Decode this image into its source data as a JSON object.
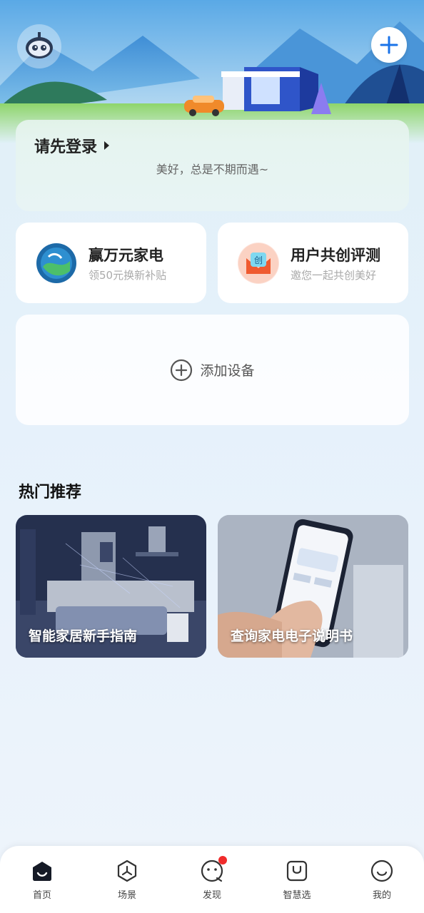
{
  "header": {
    "avatar_icon": "robot-avatar-icon",
    "add_icon": "plus-icon"
  },
  "login": {
    "title": "请先登录",
    "subtitle": "美好，总是不期而遇~"
  },
  "promos": [
    {
      "title": "赢万元家电",
      "subtitle": "领50元换新补贴",
      "icon": "globe-icon"
    },
    {
      "title": "用户共创评测",
      "subtitle": "邀您一起共创美好",
      "icon": "create-badge-icon",
      "badge": "创"
    }
  ],
  "devices": {
    "add_label": "添加设备"
  },
  "recommend": {
    "title": "热门推荐",
    "items": [
      {
        "label": "智能家居新手指南"
      },
      {
        "label": "查询家电电子说明书"
      }
    ]
  },
  "tabbar": {
    "items": [
      {
        "label": "首页",
        "icon": "home-icon"
      },
      {
        "label": "场景",
        "icon": "scene-icon"
      },
      {
        "label": "发现",
        "icon": "discover-icon"
      },
      {
        "label": "智慧选",
        "icon": "shop-icon"
      },
      {
        "label": "我的",
        "icon": "profile-icon"
      }
    ]
  },
  "colors": {
    "accent": "#1a73e8",
    "notify_dot": "#f02b2b"
  }
}
